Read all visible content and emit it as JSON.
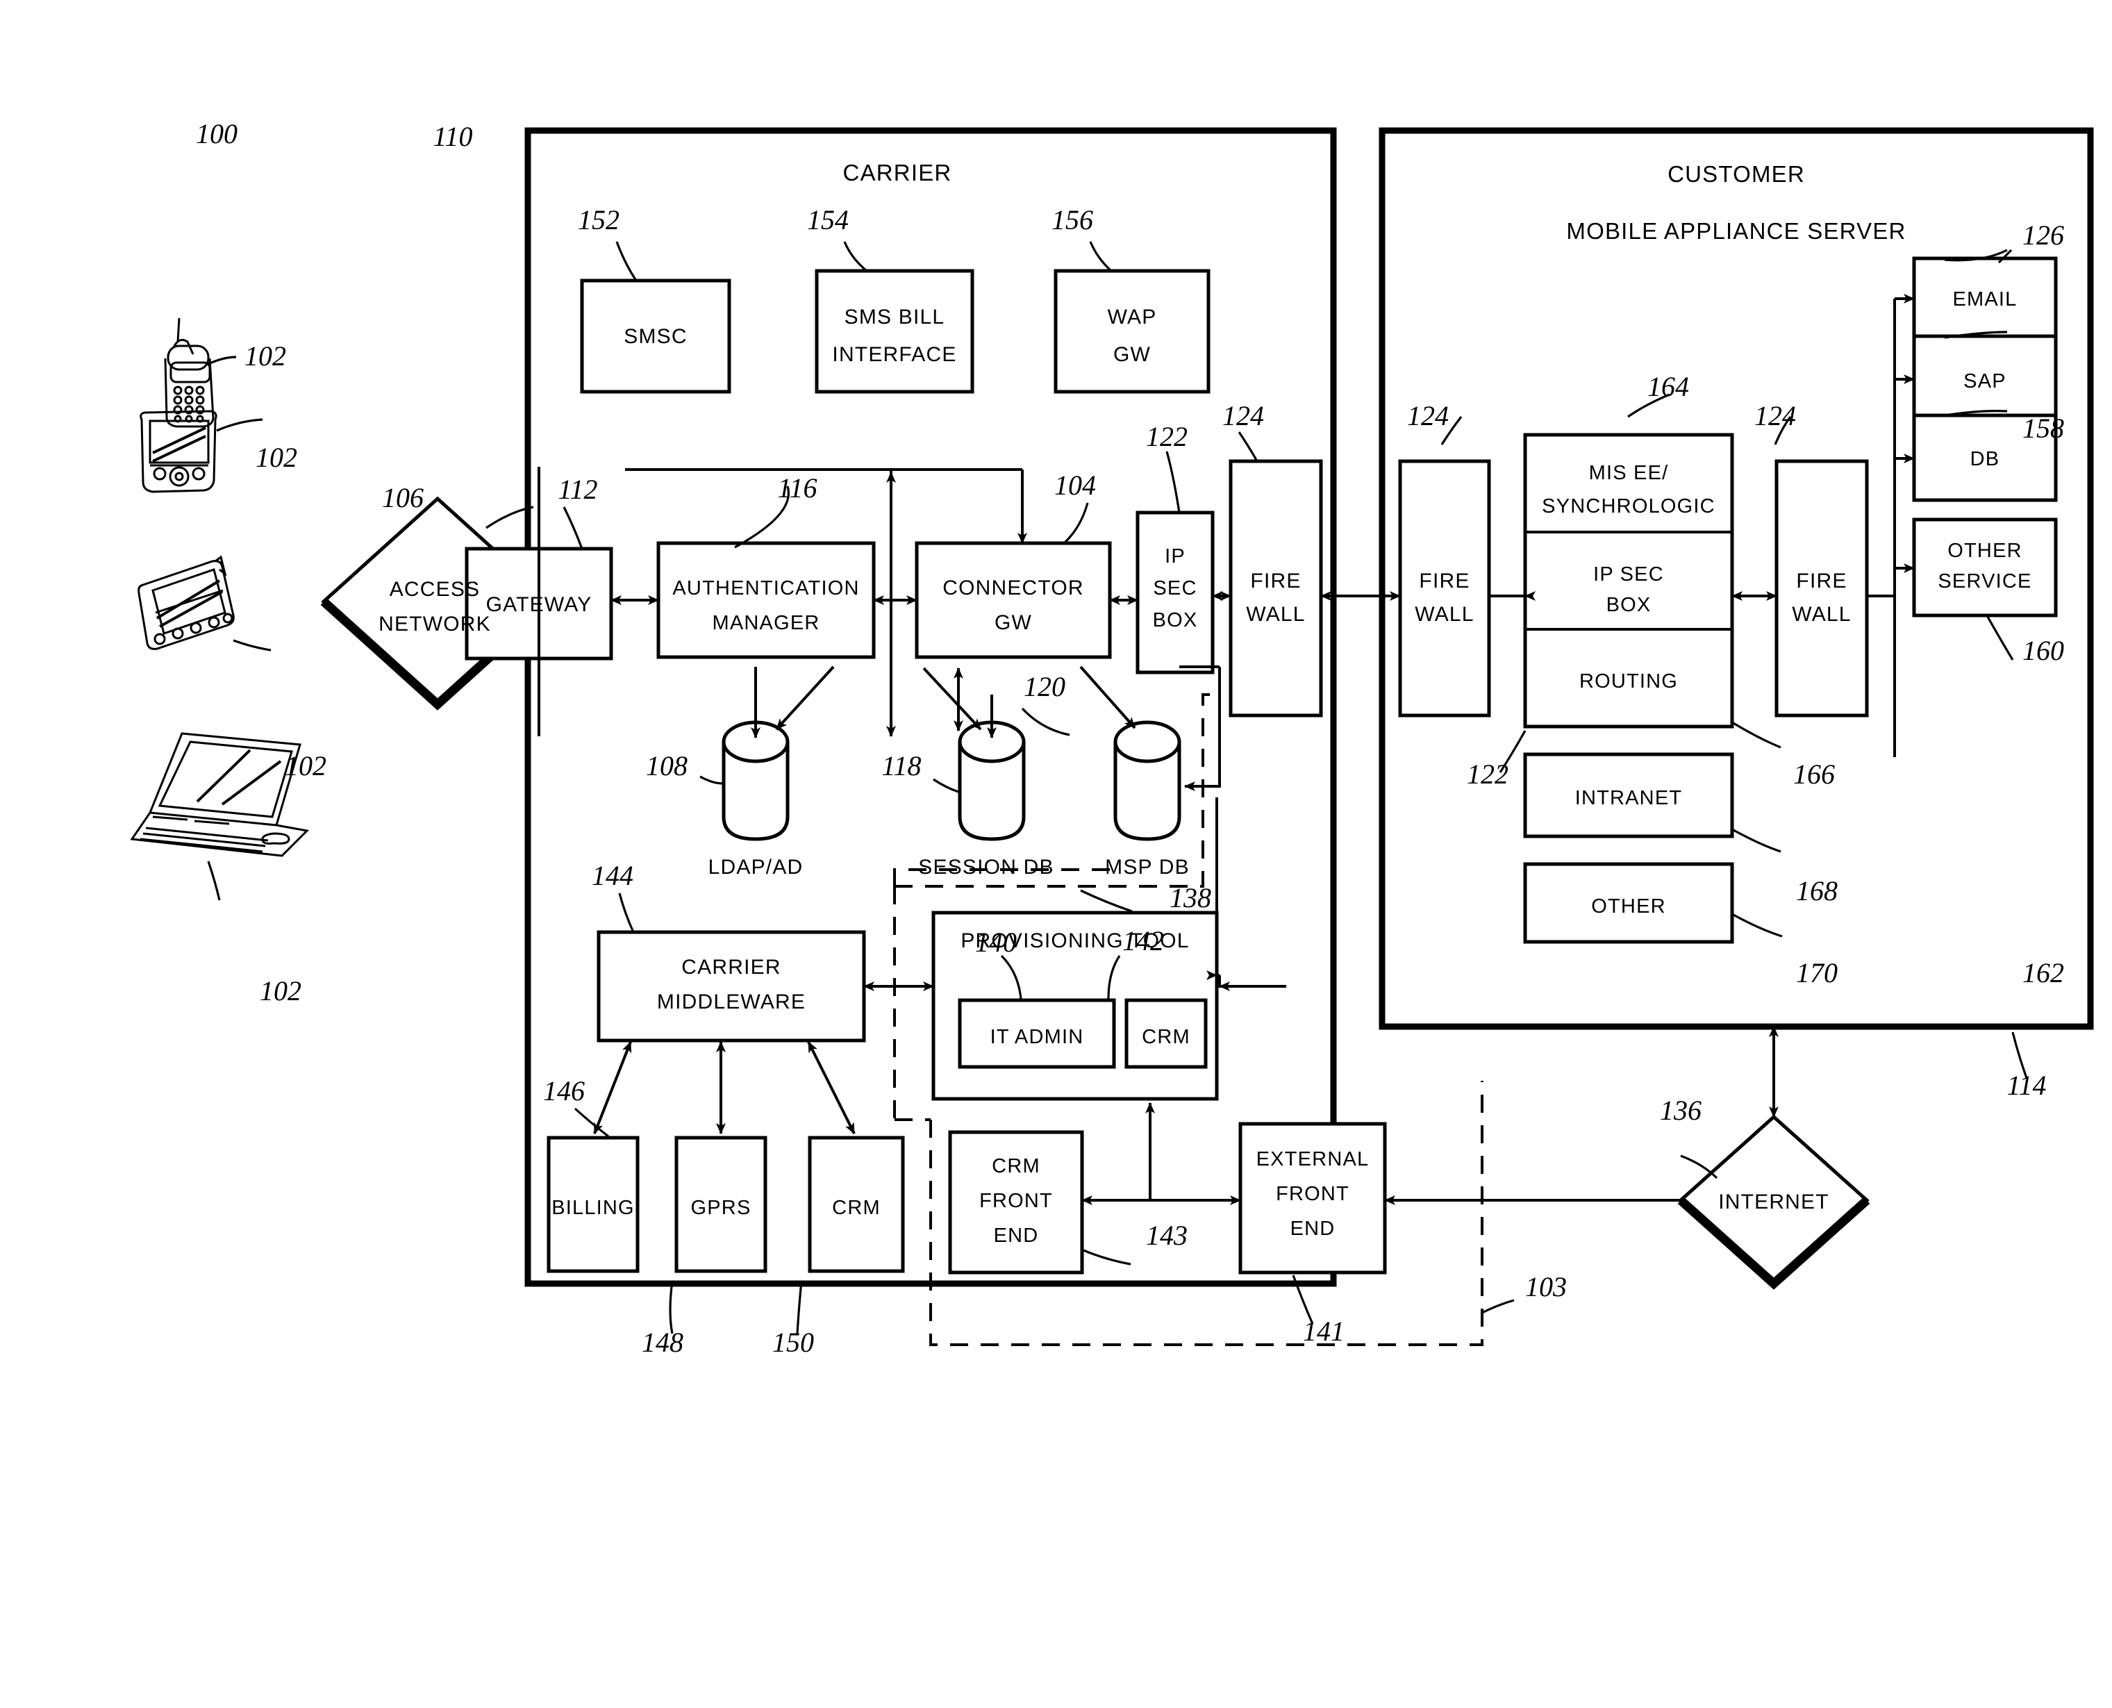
{
  "figure": {
    "system_ref": "100",
    "carrier": {
      "title": "CARRIER",
      "ref": "110",
      "top_boxes": [
        {
          "label": "SMSC",
          "ref": "152"
        },
        {
          "label": "SMS BILL INTERFACE",
          "ref": "154"
        },
        {
          "label": "WAP GW",
          "ref": "156"
        }
      ],
      "gateway": {
        "label": "GATEWAY",
        "ref": "112"
      },
      "auth_manager": {
        "label": "AUTHENTICATION MANAGER",
        "ref": "116"
      },
      "connector_gw": {
        "label": "CONNECTOR GW",
        "ref": "104"
      },
      "ip_sec_box": {
        "label": "IP SEC BOX",
        "ref": "122"
      },
      "firewall": {
        "label": "FIRE WALL",
        "ref": "124"
      },
      "databases": [
        {
          "label": "LDAP/AD",
          "ref": "108"
        },
        {
          "label": "SESSION DB",
          "ref": "118"
        },
        {
          "label": "MSP DB",
          "ref": "120"
        }
      ],
      "carrier_middleware": {
        "label": "CARRIER MIDDLEWARE",
        "ref": "144"
      },
      "provisioning_tool": {
        "label": "PROVISIONING TOOL",
        "ref": "138",
        "children": [
          {
            "label": "IT ADMIN",
            "ref": "140"
          },
          {
            "label": "CRM",
            "ref": "142"
          }
        ]
      },
      "bottom_boxes": [
        {
          "label": "BILLING",
          "ref": "146"
        },
        {
          "label": "GPRS",
          "ref": "148"
        },
        {
          "label": "CRM",
          "ref": "150"
        }
      ],
      "crm_front_end": {
        "label": "CRM FRONT END",
        "ref": "143"
      },
      "external_front_end": {
        "label": "EXTERNAL FRONT END",
        "ref": "141"
      },
      "dashed_region_ref": "103"
    },
    "customer": {
      "title_line1": "CUSTOMER",
      "title_line2": "MOBILE APPLIANCE SERVER",
      "ref": "114",
      "firewall_left": {
        "label": "FIRE WALL",
        "ref": "124"
      },
      "firewall_right": {
        "label": "FIRE WALL",
        "ref": "124"
      },
      "stack": {
        "ref_top": "164",
        "ref_ipsec": "122",
        "ref_routing": "166",
        "rows": [
          {
            "label": "MIS EE/ SYNCHROLOGIC"
          },
          {
            "label": "IP SEC BOX"
          },
          {
            "label": "ROUTING"
          }
        ]
      },
      "intranet": {
        "label": "INTRANET",
        "ref": "168"
      },
      "other": {
        "label": "OTHER",
        "ref": "170"
      },
      "services": [
        {
          "label": "EMAIL",
          "ref": "126"
        },
        {
          "label": "SAP",
          "ref": "158"
        },
        {
          "label": "DB",
          "ref": "160"
        },
        {
          "label": "OTHER SERVICE",
          "ref": "162"
        }
      ]
    },
    "left": {
      "devices_ref": "102",
      "device_icons": [
        "cellphone-icon",
        "pda-icon",
        "handheld-icon",
        "laptop-icon"
      ],
      "access_network": {
        "label": "ACCESS NETWORK",
        "ref": "106"
      }
    },
    "internet": {
      "label": "INTERNET",
      "ref": "136"
    }
  }
}
